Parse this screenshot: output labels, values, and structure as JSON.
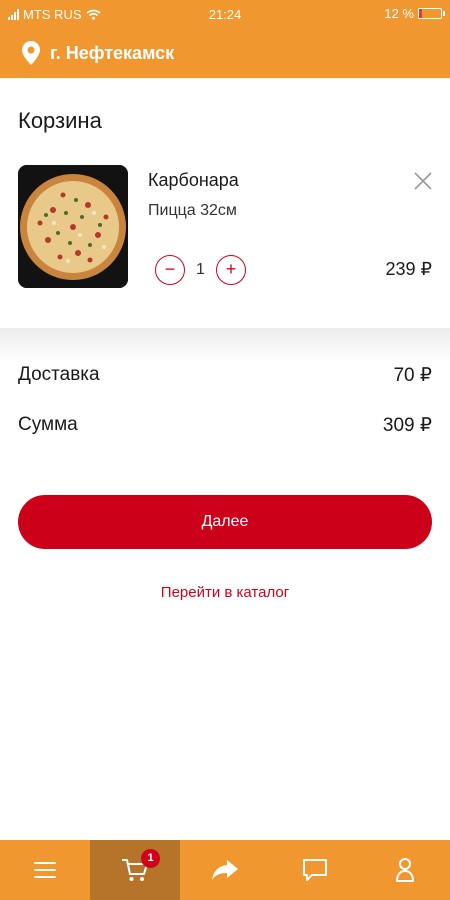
{
  "status_bar": {
    "carrier": "MTS RUS",
    "time": "21:24",
    "battery_text": "12 %",
    "battery_level": 0.12
  },
  "header": {
    "city": "г. Нефтекамск",
    "icon": "location-pin-icon"
  },
  "cart": {
    "title": "Корзина",
    "items": [
      {
        "name": "Карбонара",
        "description": "Пицца 32см",
        "quantity": "1",
        "price": "239 ₽",
        "minus_label": "−",
        "plus_label": "+"
      }
    ]
  },
  "summary": {
    "delivery_label": "Доставка",
    "delivery_value": "70 ₽",
    "total_label": "Сумма",
    "total_value": "309 ₽"
  },
  "actions": {
    "next_label": "Далее",
    "catalog_label": "Перейти в каталог"
  },
  "tabbar": {
    "tabs": [
      {
        "icon": "menu-icon"
      },
      {
        "icon": "cart-icon",
        "badge": "1",
        "active": true
      },
      {
        "icon": "share-icon"
      },
      {
        "icon": "chat-icon"
      },
      {
        "icon": "user-icon"
      }
    ]
  },
  "colors": {
    "brand_orange": "#f0982f",
    "active_tab": "#b5742a",
    "accent_red": "#cc0018"
  }
}
